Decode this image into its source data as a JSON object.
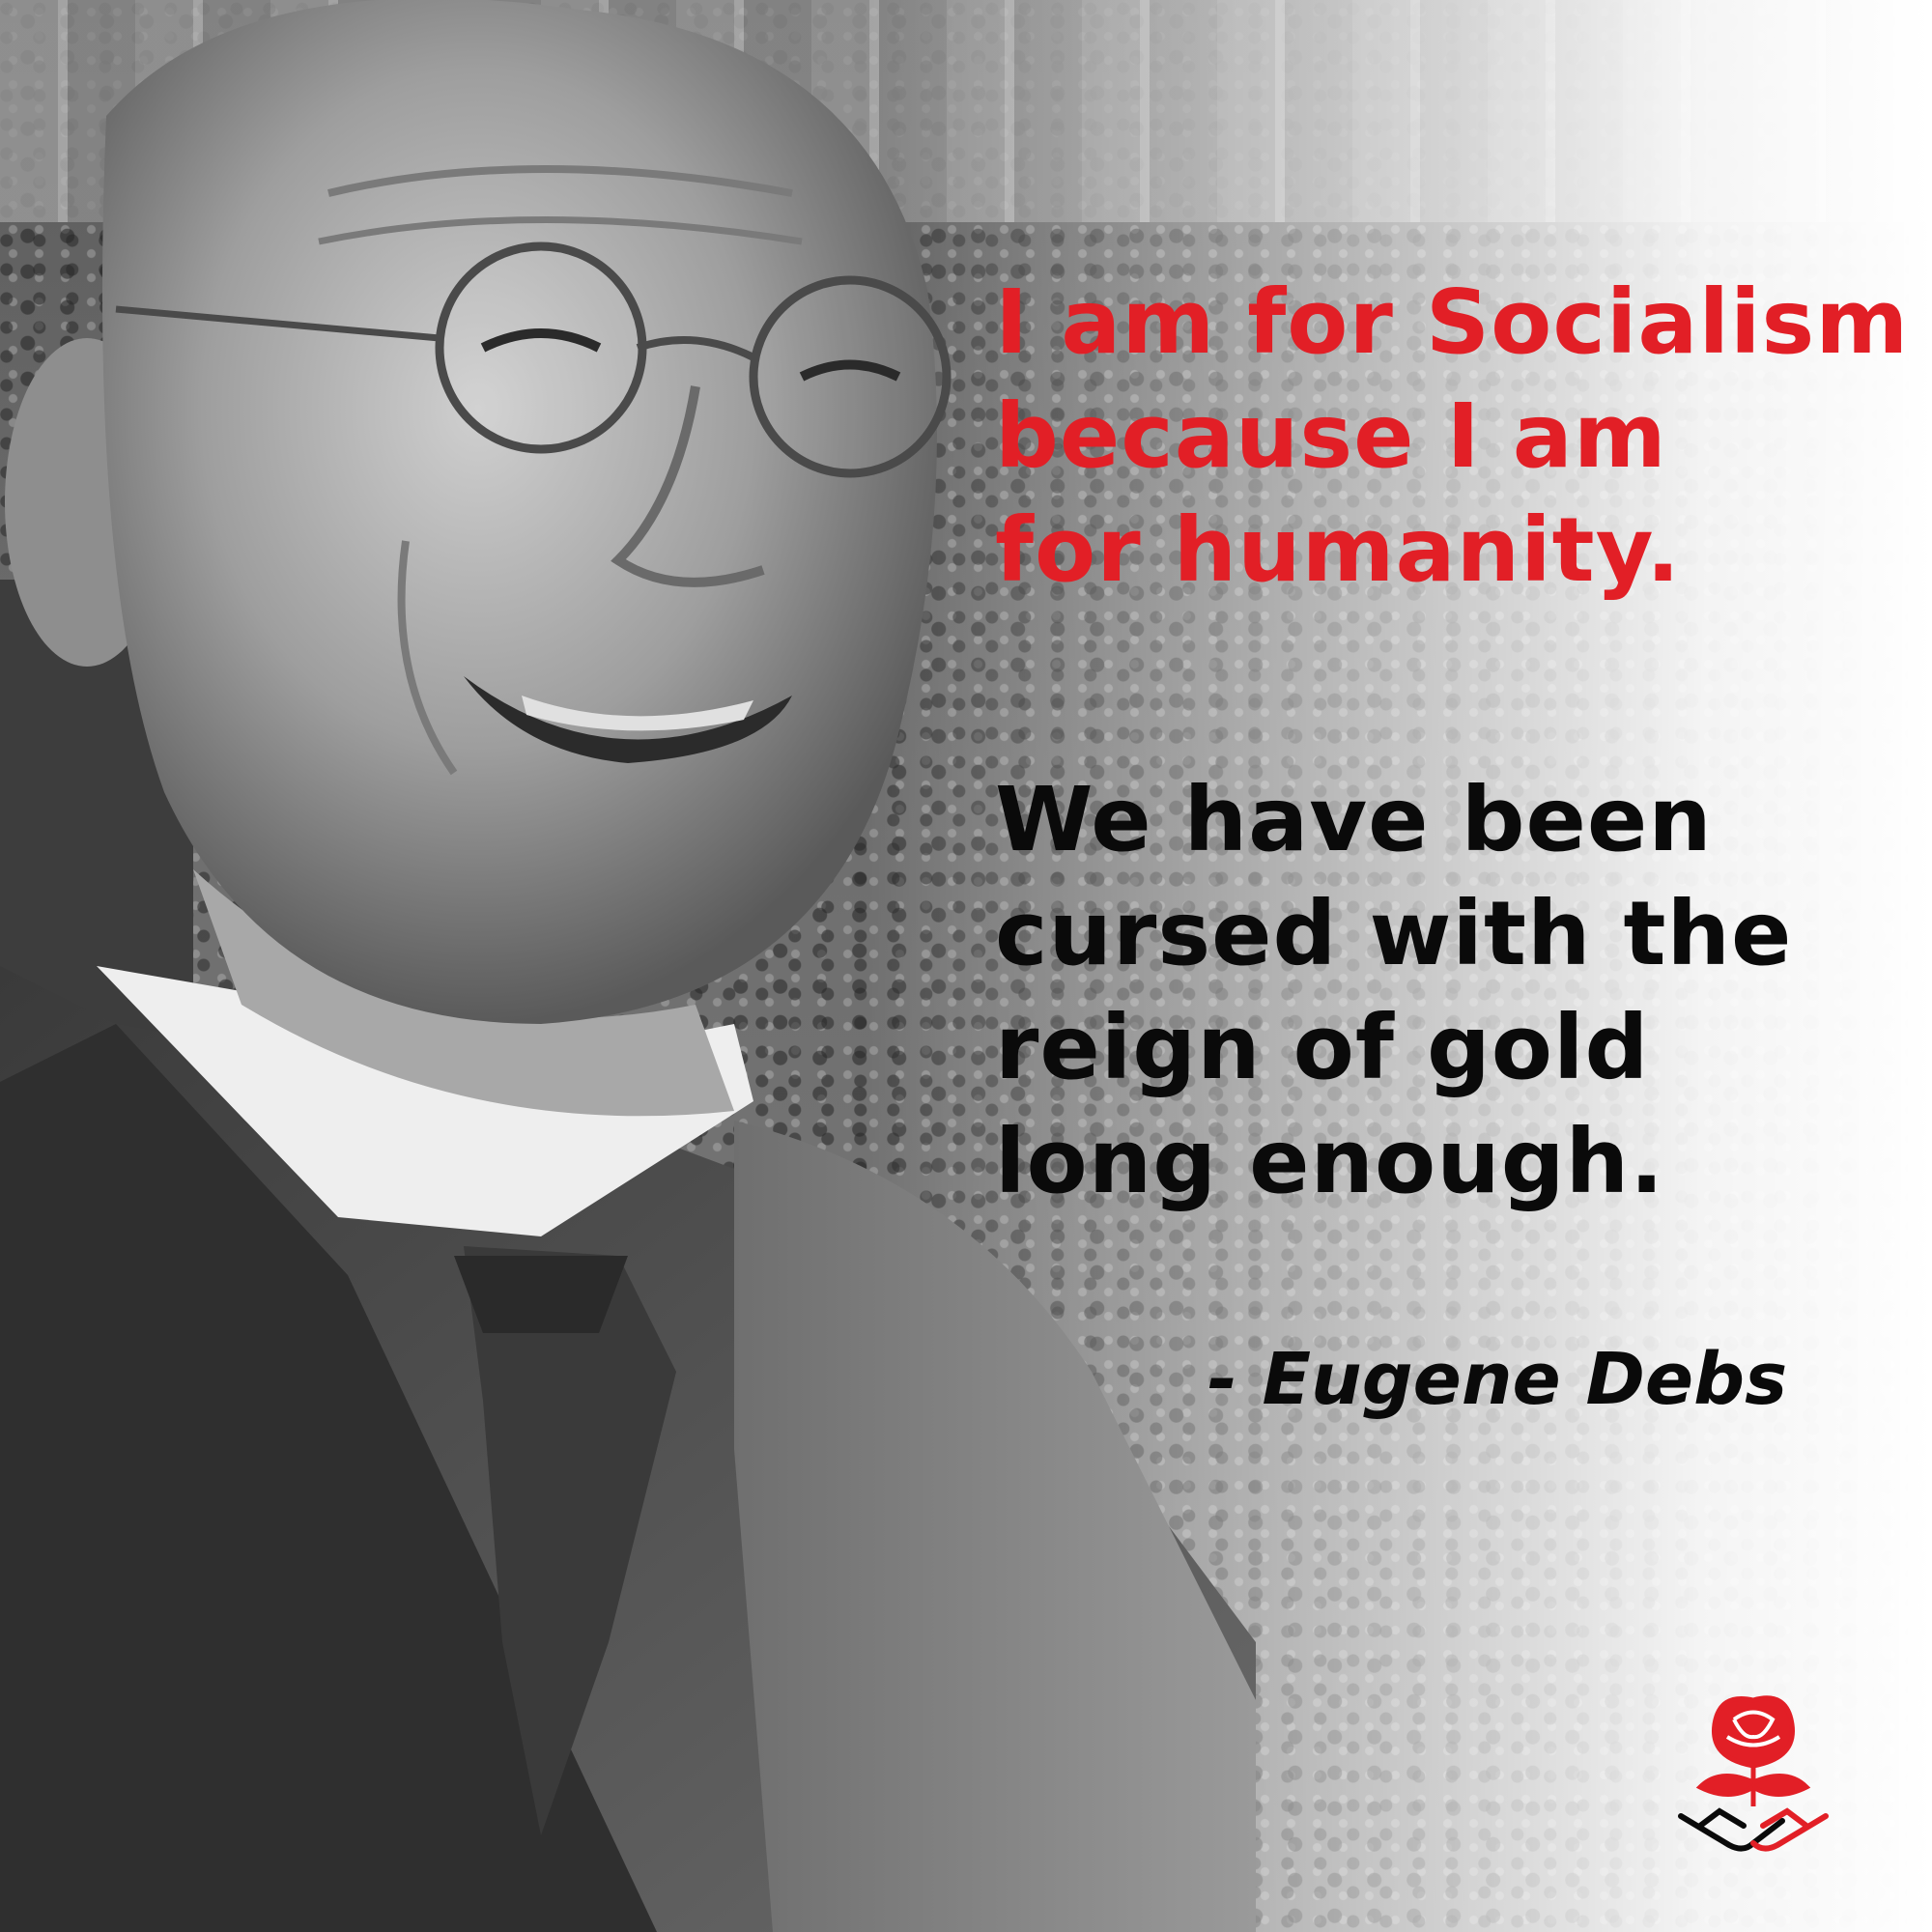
{
  "quote": {
    "red_lines": [
      "I am for Socialism",
      "because I am",
      "for humanity."
    ],
    "black_lines": [
      "We have been",
      "cursed with the",
      "reign of gold",
      "long enough."
    ],
    "attribution": "- Eugene Debs"
  },
  "colors": {
    "accent_red": "#e21f26",
    "text_black": "#0a0a0a"
  },
  "logo": {
    "icon": "rose-handshake-icon"
  },
  "photo": {
    "subject": "smiling-man-portrait",
    "background": "crowd-photo"
  }
}
